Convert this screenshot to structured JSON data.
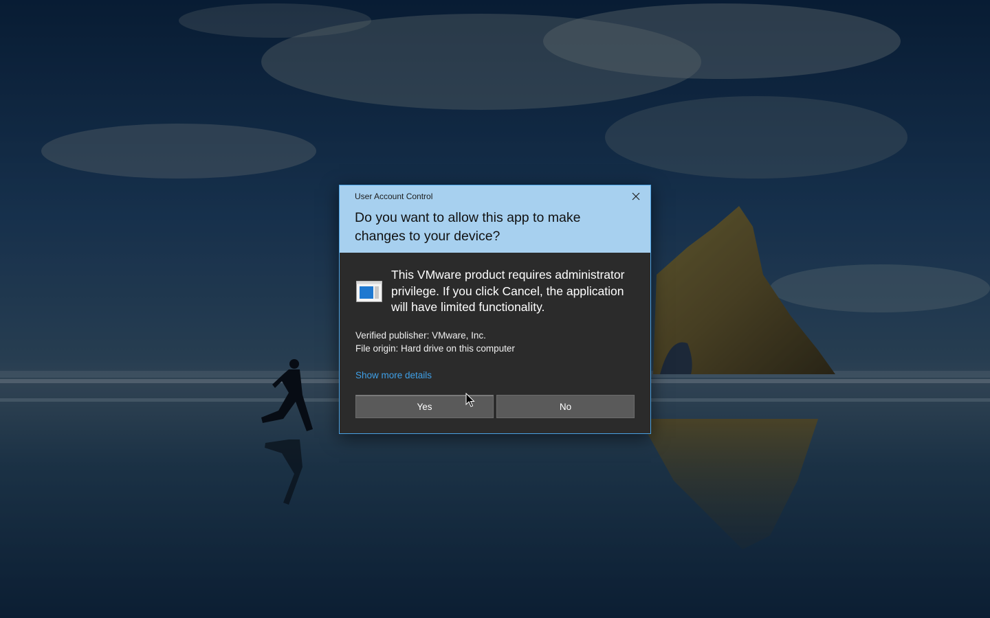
{
  "dialog": {
    "title": "User Account Control",
    "question": "Do you want to allow this app to make changes to your device?",
    "description": "This VMware product requires administrator privilege. If you click Cancel, the application will have limited functionality.",
    "publisher": "Verified publisher: VMware, Inc.",
    "origin": "File origin: Hard drive on this computer",
    "more_details_label": "Show more details",
    "yes_label": "Yes",
    "no_label": "No",
    "close_icon": "close-icon",
    "app_icon": "application-window-icon"
  },
  "colors": {
    "header_bg": "#a7d0ef",
    "body_bg": "#2b2b2b",
    "link": "#3fa0e8",
    "button_bg": "#5a5a5a",
    "border_accent": "#4aa3e6"
  }
}
